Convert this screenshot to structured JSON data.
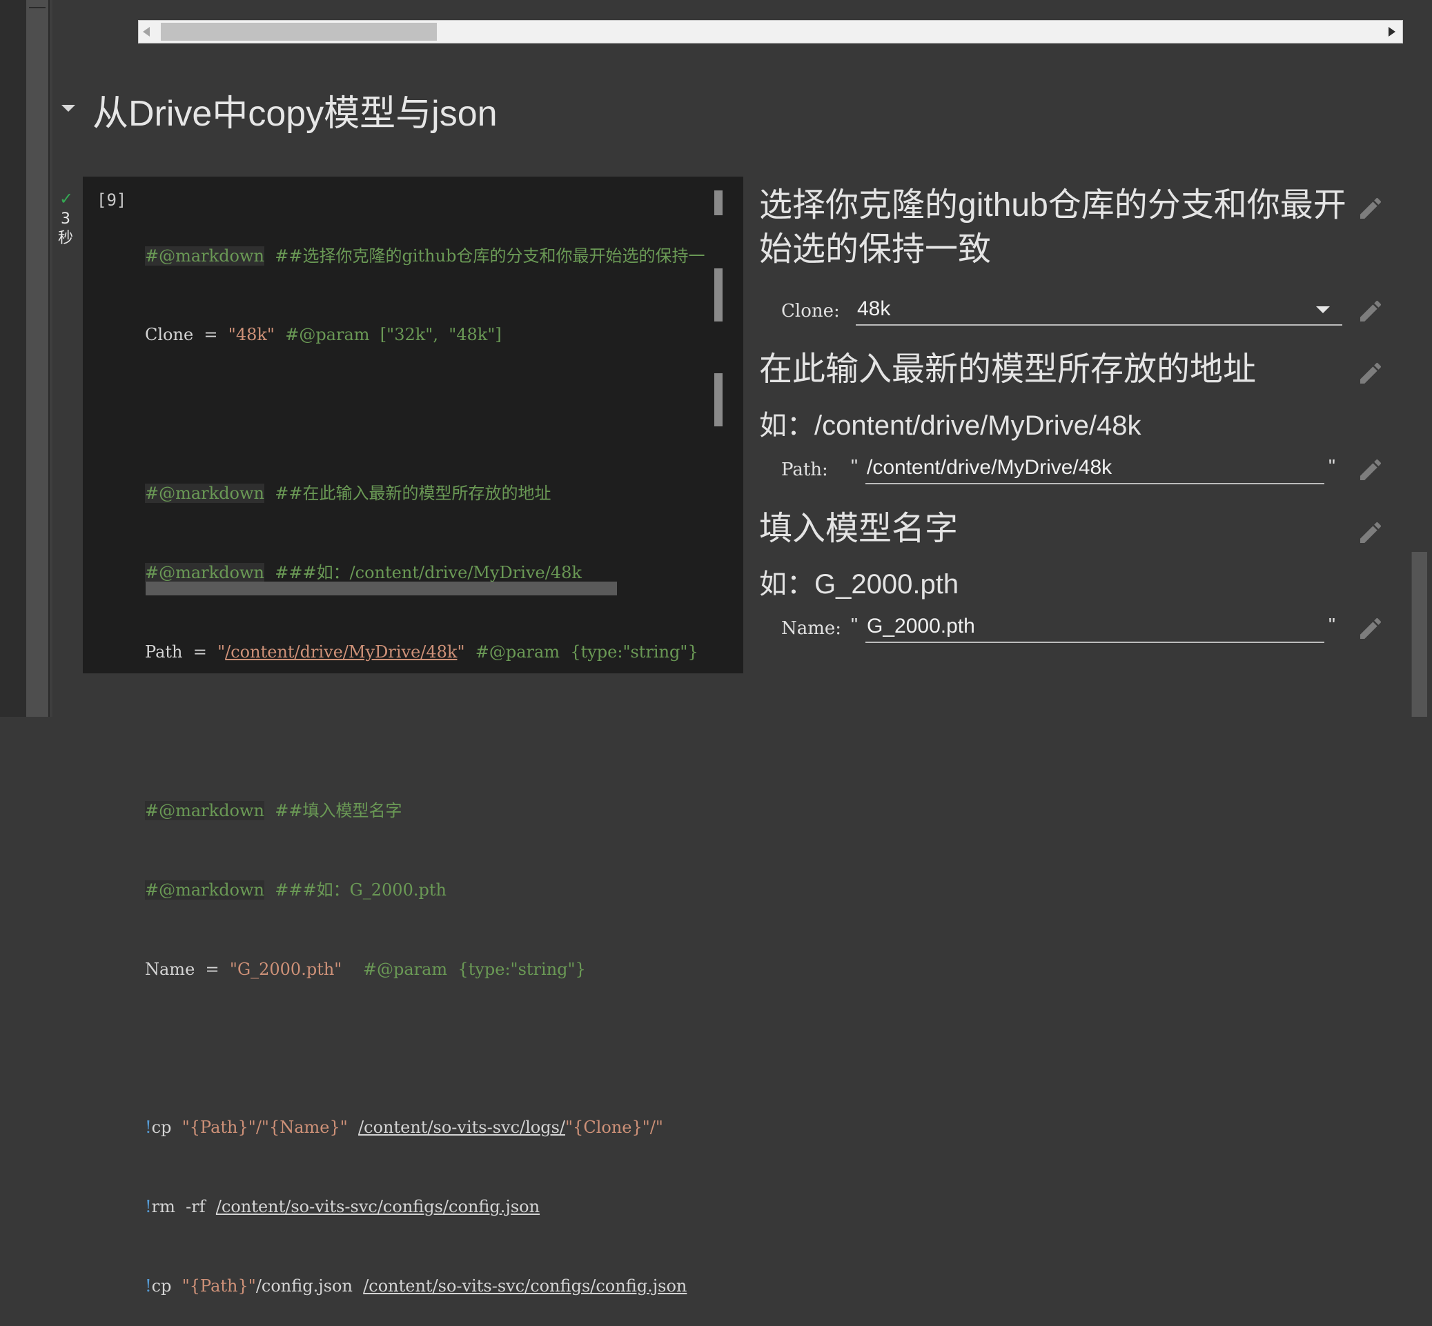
{
  "section": {
    "title": "从Drive中copy模型与json"
  },
  "cell": {
    "execution_count": "[9]",
    "status_time_num": "3",
    "status_time_unit": "秒"
  },
  "code_lines": {
    "l1_md": "#@markdown",
    "l1_rest": "  ##选择你克隆的github仓库的分支和你最开始选的保持一",
    "l2_a": "Clone  =  ",
    "l2_str": "\"48k\"",
    "l2_comment": "  #@param  [\"32k\",  \"48k\"]",
    "l4_md": "#@markdown",
    "l4_rest": "  ##在此输入最新的模型所存放的地址",
    "l5_md": "#@markdown",
    "l5_rest": "  ###如：/content/drive/MyDrive/48k",
    "l6_a": "Path  =  ",
    "l6_q1": "\"",
    "l6_path": "/content/drive/MyDrive/48k",
    "l6_q2": "\"",
    "l6_comment": "  #@param  {type:\"string\"}",
    "l8_md": "#@markdown",
    "l8_rest": "  ##填入模型名字",
    "l9_md": "#@markdown",
    "l9_rest": "  ###如：G_2000.pth",
    "l10_a": "Name  =  ",
    "l10_str": "\"G_2000.pth\"",
    "l10_comment": "    #@param  {type:\"string\"}",
    "l12_bang": "!",
    "l12_cmd": "cp  ",
    "l12_s1": "\"{Path}\"/\"{Name}\"",
    "l12_path": "/content/so-vits-svc/logs/",
    "l12_s2": "\"{Clone}\"/\"",
    "l13_bang": "!",
    "l13_cmd": "rm  -rf  ",
    "l13_path": "/content/so-vits-svc/configs/config.json",
    "l14_bang": "!",
    "l14_cmd": "cp  ",
    "l14_s1": "\"{Path}\"",
    "l14_mid": "/config.json  ",
    "l14_path": "/content/so-vits-svc/configs/config.json"
  },
  "form": {
    "heading1_line1": "选择你克隆的github仓库的分支和你最开",
    "heading1_line2": "始选的保持一致",
    "clone_label": "Clone:",
    "clone_value": "48k",
    "heading2": "在此输入最新的模型所存放的地址",
    "sub2": "如：/content/drive/MyDrive/48k",
    "path_label": "Path:",
    "path_value": "/content/drive/MyDrive/48k",
    "heading3": "填入模型名字",
    "sub3": "如：G_2000.pth",
    "name_label": "Name:",
    "name_value": "G_2000.pth",
    "quote": "\""
  },
  "icons": [
    "chevron-down-icon",
    "check-icon",
    "pencil-icon",
    "dropdown-arrow-icon",
    "scroll-left-icon",
    "scroll-right-icon"
  ]
}
